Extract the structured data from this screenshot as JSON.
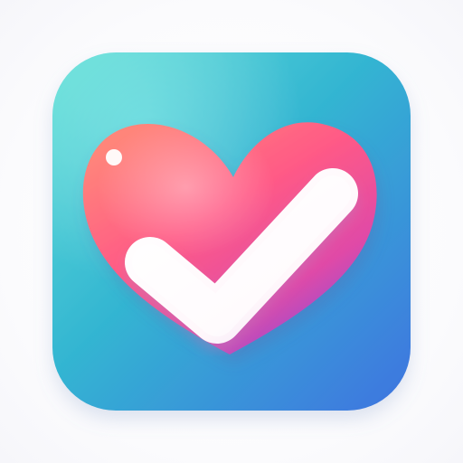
{
  "app_icon": {
    "name": "heart-check-app-icon",
    "colors": {
      "tile_gradient_top_left": "#5fe0d6",
      "tile_gradient_mid": "#33b5d2",
      "tile_gradient_bottom_right": "#3f73e0",
      "heart_gradient_top": "#ff7f7a",
      "heart_gradient_mid": "#ff4f86",
      "heart_gradient_bottom": "#9a4fd6",
      "check_fill": "#ffffff",
      "check_shadow": "#ead9f2",
      "heart_highlight_dot": "#ffffff"
    }
  }
}
